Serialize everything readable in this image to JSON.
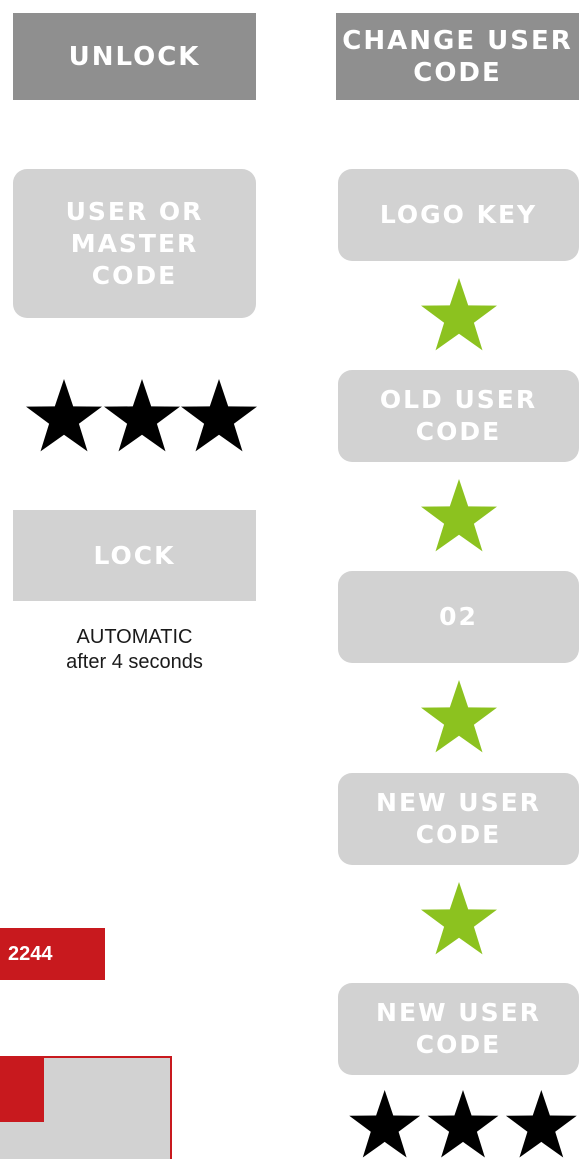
{
  "columns": {
    "unlock": {
      "header": "UNLOCK",
      "code_box": "USER OR\nMASTER\nCODE",
      "confirmation_stars": 3,
      "lock_box": "LOCK",
      "lock_note": "AUTOMATIC\nafter 4 seconds"
    },
    "change_user_code": {
      "header": "CHANGE USER\nCODE",
      "steps": [
        "LOGO KEY",
        "OLD USER\nCODE",
        "02",
        "NEW USER\nCODE",
        "NEW USER\nCODE"
      ],
      "stars_between_steps": 1,
      "final_stars": 3
    }
  },
  "bottom_left": {
    "code_tab": "2244"
  },
  "colors": {
    "header_gray": "#8f8f8f",
    "step_gray": "#d2d2d2",
    "star_green": "#8cc21f",
    "accent_red": "#c8191e"
  },
  "icons": {
    "star": "star-icon"
  }
}
